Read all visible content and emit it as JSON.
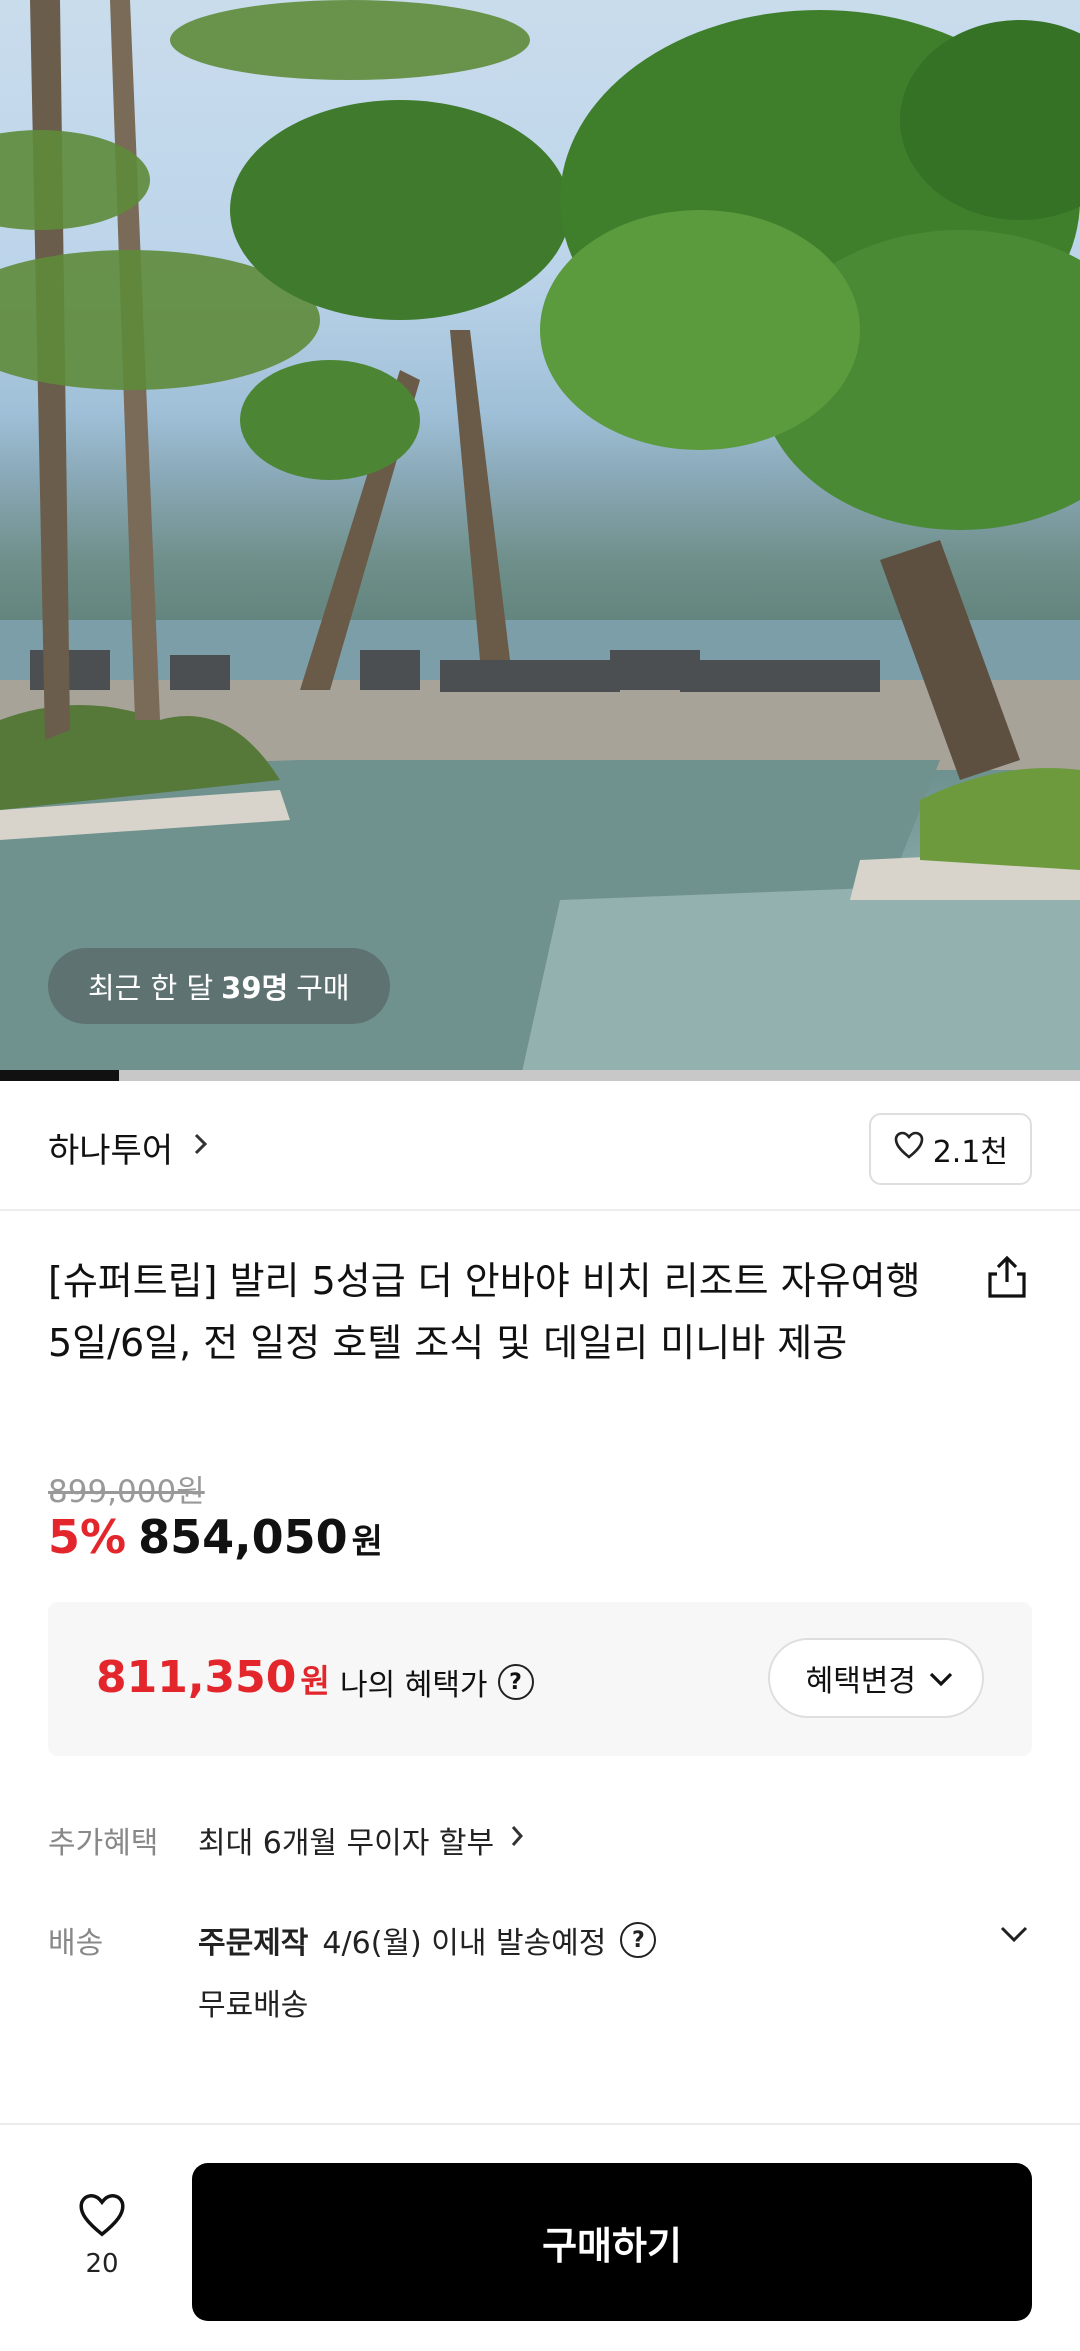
{
  "hero": {
    "badge_prefix": "최근 한 달",
    "badge_count": "39명",
    "badge_suffix": "구매",
    "slide_progress": 0.11
  },
  "seller": {
    "name": "하나투어",
    "like_count": "2.1천"
  },
  "product": {
    "title": "[슈퍼트립] 발리 5성급 더 안바야 비치 리조트 자유여행 5일/6일, 전 일정 호텔 조식 및 데일리 미니바 제공",
    "original_price": "899,000원",
    "discount_rate": "5%",
    "sale_price": "854,050",
    "sale_unit": "원"
  },
  "benefit": {
    "price": "811,350",
    "unit": "원",
    "label": "나의 혜택가",
    "button_label": "혜택변경"
  },
  "extra_benefit": {
    "label": "추가혜택",
    "value": "최대 6개월 무이자 할부"
  },
  "shipping": {
    "label": "배송",
    "type": "주문제작",
    "date": "4/6(월) 이내 발송예정",
    "fee": "무료배송"
  },
  "bottom_bar": {
    "wish_count": "20",
    "buy_label": "구매하기"
  },
  "colors": {
    "accent_red": "#e2262c",
    "buy_button": "#000000"
  }
}
